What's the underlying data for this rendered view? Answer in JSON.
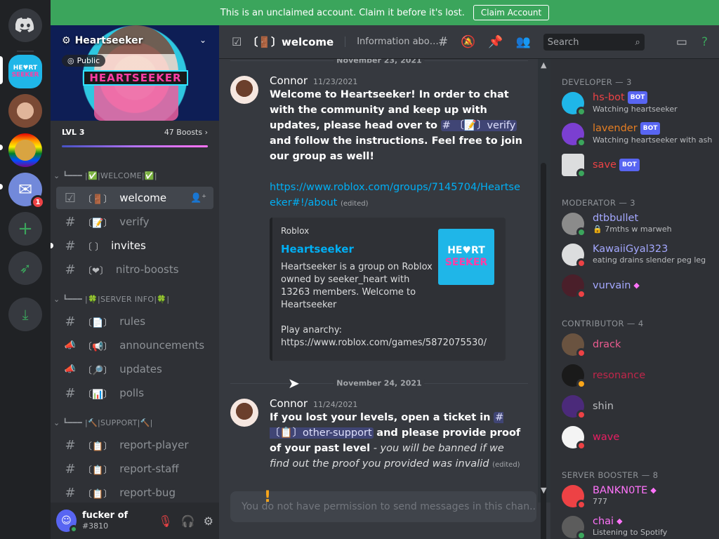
{
  "banner": {
    "text": "This is an unclaimed account. Claim it before it's lost.",
    "button": "Claim Account"
  },
  "rail": {
    "mail_badge": "1"
  },
  "server": {
    "name": "Heartseeker",
    "public": "Public",
    "banner_logo": "HEARTSEEKER",
    "level": "LVL 3",
    "boosts": "47 Boosts"
  },
  "categories": [
    {
      "label": "|✅|WELCOME|✅|"
    },
    {
      "label": "|🍀|SERVER INFO|🍀|"
    },
    {
      "label": "|🔨|SUPPORT|🔨|"
    }
  ],
  "channels": [
    {
      "icon": "☑",
      "emoji": "〔🚪〕",
      "label": "welcome"
    },
    {
      "icon": "#",
      "emoji": "〔📝〕",
      "label": "verify"
    },
    {
      "icon": "#",
      "emoji": "〔  〕",
      "label": "invites"
    },
    {
      "icon": "#",
      "emoji": "〔❤〕",
      "label": "nitro-boosts"
    },
    {
      "icon": "#",
      "emoji": "〔📄〕",
      "label": "rules"
    },
    {
      "icon": "📣",
      "emoji": "〔📢〕",
      "label": "announcements"
    },
    {
      "icon": "📣",
      "emoji": "〔🔎〕",
      "label": "updates"
    },
    {
      "icon": "#",
      "emoji": "〔📊〕",
      "label": "polls"
    },
    {
      "icon": "#",
      "emoji": "〔📋〕",
      "label": "report-player"
    },
    {
      "icon": "#",
      "emoji": "〔📋〕",
      "label": "report-staff"
    },
    {
      "icon": "#",
      "emoji": "〔📋〕",
      "label": "report-bug"
    }
  ],
  "user": {
    "name": "fucker of",
    "tag": "#3810"
  },
  "header": {
    "channel": "〔🚪〕welcome",
    "topic": "Information about t...",
    "search_placeholder": "Search"
  },
  "messages": {
    "date1": "November 23, 2021",
    "date2": "November 24, 2021",
    "m1": {
      "author": "Connor",
      "time": "11/23/2021",
      "text_a": "Welcome to Heartseeker! In order to chat with the community and keep up with updates, please head over to",
      "mention": "# 〔📝〕verify",
      "text_b": "and follow the instructions. Feel free to join our group as well!",
      "link": "https://www.roblox.com/groups/7145704/Heartseeker#!/about",
      "edited": "(edited)"
    },
    "embed": {
      "provider": "Roblox",
      "title": "Heartseeker",
      "description": "Heartseeker is a group on Roblox owned by seeker_heart with 13263 members. Welcome to Heartseeker\n\nPlay anarchy:\nhttps://www.roblox.com/games/5872075530/",
      "thumb_l1": "HE♥RT",
      "thumb_l2": "SEEKER"
    },
    "m2": {
      "author": "Connor",
      "time": "11/24/2021",
      "text_a": "If you lost your levels, open a ticket in",
      "mention": "# 〔📋〕other-support",
      "text_b": "and please provide proof of your past level",
      "text_c": "- you will be banned if we find out the proof you provided was invalid",
      "edited": "(edited)"
    },
    "composer": "You do not have permission to send messages in this chan..."
  },
  "members": {
    "groups": [
      "DEVELOPER — 3",
      "MODERATOR — 3",
      "CONTRIBUTOR — 4",
      "SERVER BOOSTER — 8"
    ],
    "bot_label": "BOT",
    "list": [
      {
        "name": "hs-bot",
        "status": "Watching heartseeker",
        "color": "#ed4245",
        "bot": true
      },
      {
        "name": "lavender",
        "status": "Watching heartseeker with ash",
        "color": "#e67e22",
        "bot": true
      },
      {
        "name": "save",
        "status": "",
        "color": "#ed4245",
        "bot": true
      },
      {
        "name": "dtbbullet",
        "status": "🔒 7mths w marweh",
        "color": "#a4a8ff"
      },
      {
        "name": "KawaiiGyal323",
        "status": "eating drains slender peg leg",
        "color": "#a4a8ff"
      },
      {
        "name": "vurvain",
        "status": "",
        "color": "#a4a8ff"
      },
      {
        "name": "drack",
        "status": "",
        "color": "#eb5b8f"
      },
      {
        "name": "resonance",
        "status": "",
        "color": "#c0264a"
      },
      {
        "name": "shin",
        "status": "",
        "color": "#b9bbbe"
      },
      {
        "name": "wave",
        "status": "",
        "color": "#e91e63"
      },
      {
        "name": "BANKN0TE",
        "status": "777",
        "color": "#ff73fa"
      },
      {
        "name": "chai",
        "status": "Listening to Spotify",
        "color": "#ff73fa"
      }
    ]
  }
}
